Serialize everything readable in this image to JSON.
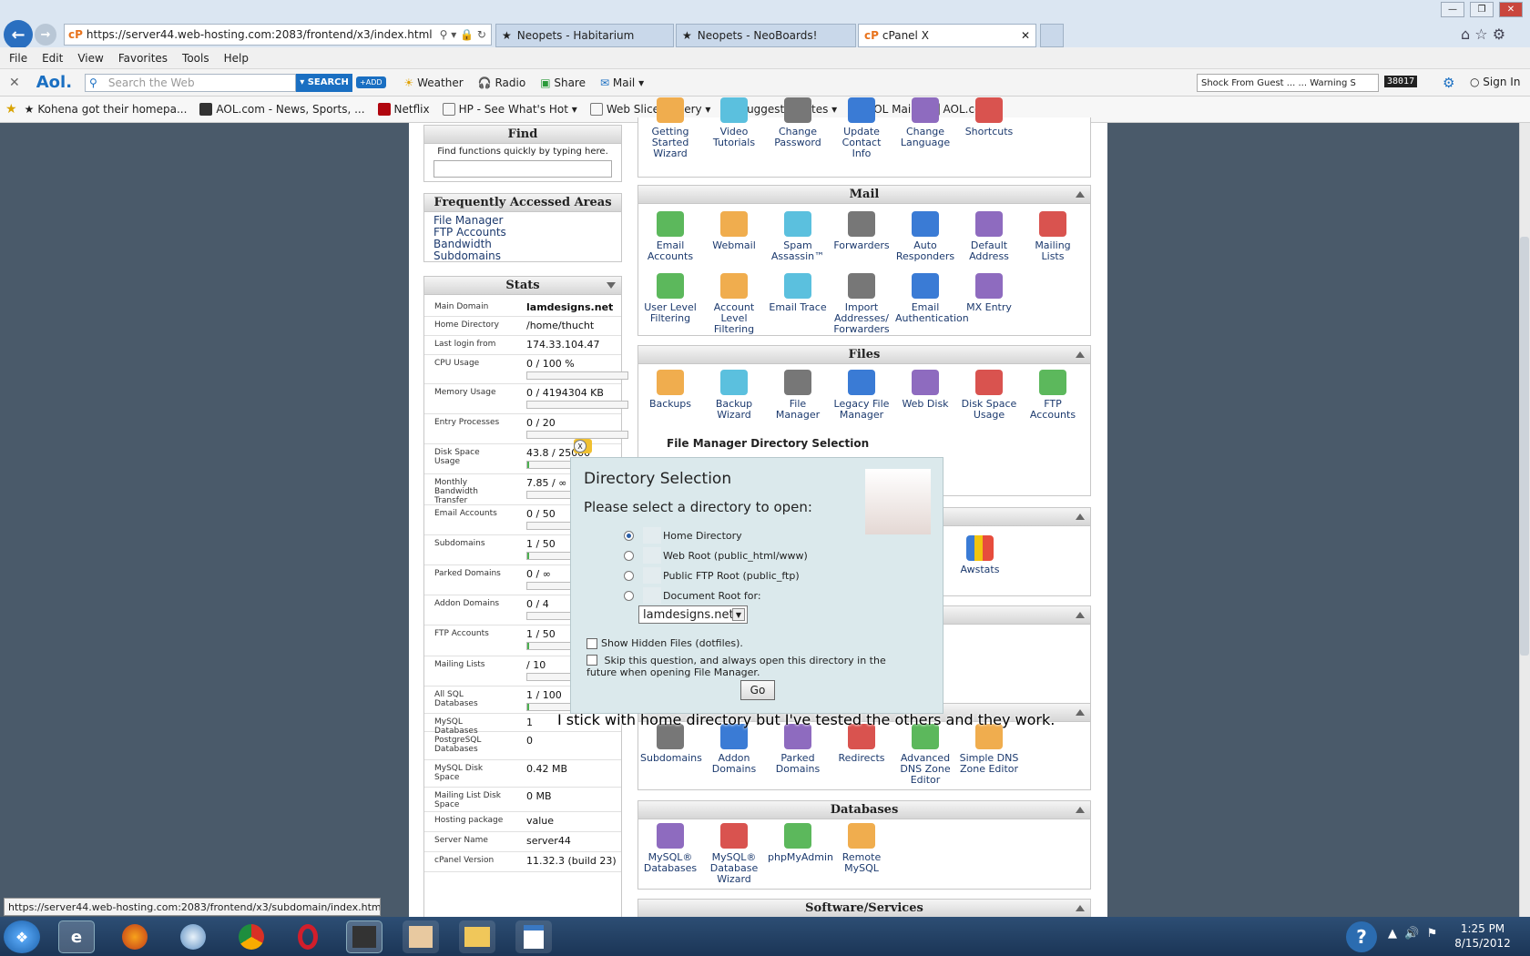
{
  "browser": {
    "url": "https://server44.web-hosting.com:2083/frontend/x3/index.html",
    "tabs": [
      {
        "label": "Neopets - Habitarium"
      },
      {
        "label": "Neopets - NeoBoards!"
      },
      {
        "label": "cPanel X"
      }
    ],
    "menu": [
      "File",
      "Edit",
      "View",
      "Favorites",
      "Tools",
      "Help"
    ],
    "aol": {
      "logo": "Aol.",
      "search_placeholder": "Search the Web",
      "search_label": "SEARCH",
      "add_label": "+ADD",
      "weather": "Weather",
      "radio": "Radio",
      "share": "Share",
      "mail": "Mail",
      "ticker": "Shock From Guest ...  ... Warning S",
      "counter": "38017",
      "signin": "Sign In"
    },
    "favorites": [
      "Kohena got their homepa...",
      "AOL.com - News, Sports, ...",
      "Netflix",
      "HP - See What's Hot",
      "Web Slice Gallery",
      "Suggested Sites",
      "AOL Mail",
      "AOL.com"
    ],
    "status_url": "https://server44.web-hosting.com:2083/frontend/x3/subdomain/index.html"
  },
  "sidebar": {
    "find_title": "Find",
    "find_hint": "Find functions quickly by typing here.",
    "faa_title": "Frequently Accessed Areas",
    "faa_links": [
      "File Manager",
      "FTP Accounts",
      "Bandwidth",
      "Subdomains"
    ],
    "stats_title": "Stats",
    "stats": [
      {
        "label": "Main Domain",
        "value": "lamdesigns.net",
        "bold": true
      },
      {
        "label": "Home Directory",
        "value": "/home/thucht"
      },
      {
        "label": "Last login from",
        "value": "174.33.104.47"
      },
      {
        "label": "CPU Usage",
        "value": "0 / 100 %",
        "bar": 0
      },
      {
        "label": "Memory Usage",
        "value": "0 / 4194304 KB",
        "bar": 0
      },
      {
        "label": "Entry Processes",
        "value": "0 / 20",
        "bar": 0
      },
      {
        "label": "Disk Space Usage",
        "value": "43.8 / 25000",
        "bar": 0.01
      },
      {
        "label": "Monthly Bandwidth Transfer",
        "value": "7.85 / ∞ MB",
        "bar": 0
      },
      {
        "label": "Email Accounts",
        "value": "0 / 50",
        "bar": 0
      },
      {
        "label": "Subdomains",
        "value": "1 / 50",
        "bar": 0.02
      },
      {
        "label": "Parked Domains",
        "value": "0 / ∞",
        "bar": 0
      },
      {
        "label": "Addon Domains",
        "value": "0 / 4",
        "bar": 0
      },
      {
        "label": "FTP Accounts",
        "value": "1 / 50",
        "bar": 0.02
      },
      {
        "label": "Mailing Lists",
        "value": "/ 10",
        "bar": 0
      },
      {
        "label": "All SQL Databases",
        "value": "1 / 100",
        "bar": 0.01
      },
      {
        "label": "MySQL Databases",
        "value": "1"
      },
      {
        "label": "PostgreSQL Databases",
        "value": "0"
      },
      {
        "label": "MySQL Disk Space",
        "value": "0.42 MB"
      },
      {
        "label": "Mailing List Disk Space",
        "value": "0 MB"
      },
      {
        "label": "Hosting package",
        "value": "value"
      },
      {
        "label": "Server Name",
        "value": "server44"
      },
      {
        "label": "cPanel Version",
        "value": "11.32.3 (build 23)"
      }
    ]
  },
  "main": {
    "prefs_icons": [
      "Getting Started Wizard",
      "Video Tutorials",
      "Change Password",
      "Update Contact Info",
      "Change Language",
      "Shortcuts"
    ],
    "mail_title": "Mail",
    "mail_icons": [
      "Email Accounts",
      "Webmail",
      "Spam Assassin™",
      "Forwarders",
      "Auto Responders",
      "Default Address",
      "Mailing Lists",
      "User Level Filtering",
      "Account Level Filtering",
      "Email Trace",
      "Import Addresses/ Forwarders",
      "Email Authentication",
      "MX Entry"
    ],
    "files_title": "Files",
    "files_icons": [
      "Backups",
      "Backup Wizard",
      "File Manager",
      "Legacy File Manager",
      "Web Disk",
      "Disk Space Usage",
      "FTP Accounts"
    ],
    "logs_icons_visible": [
      "Awstats"
    ],
    "domains_icons": [
      "Subdomains",
      "Addon Domains",
      "Parked Domains",
      "Redirects",
      "Advanced DNS Zone Editor",
      "Simple DNS Zone Editor"
    ],
    "databases_title": "Databases",
    "databases_icons": [
      "MySQL® Databases",
      "MySQL® Database Wizard",
      "phpMyAdmin",
      "Remote MySQL"
    ],
    "software_title": "Software/Services"
  },
  "dialog": {
    "bar_title": "File Manager Directory Selection",
    "close": "X",
    "title": "Directory Selection",
    "prompt": "Please select a directory to open:",
    "options": [
      "Home Directory",
      "Web Root (public_html/www)",
      "Public FTP Root (public_ftp)",
      "Document Root for:"
    ],
    "selected_index": 0,
    "domain_select": "lamdesigns.net",
    "show_hidden": "Show Hidden Files (dotfiles).",
    "skip": "Skip this question, and always open this directory in the future when opening File Manager.",
    "go": "Go"
  },
  "caption": "I stick with home directory but I've tested the others and they work.",
  "taskbar": {
    "time": "1:25 PM",
    "date": "8/15/2012"
  }
}
